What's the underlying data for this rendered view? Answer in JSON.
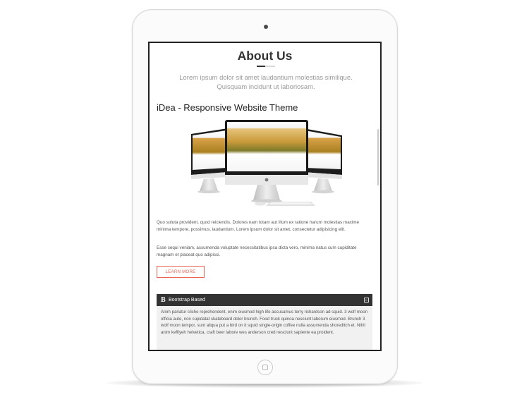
{
  "section": {
    "title": "About Us",
    "subtitle": "Lorem ipsum dolor sit amet laudantium molestias similique. Quisquam incidunt ut laboriosam."
  },
  "product": {
    "heading": "iDea - Responsive Website Theme"
  },
  "paragraphs": [
    "Quo soluta provident, quod reiciendis. Dolores nam totam aut illum ex ratione harum molestias maxime minima tempore, possimus, laudantium. Lorem ipsum dolor sit amet, consectetur adipisicing elit.",
    "Esse sequi veniam, assumenda voluptate necessitatibus ipsa dicta vero, minima natus cum cupiditate magnam et placeat quo adipisci."
  ],
  "learn_more_label": "LEARN MORE",
  "accordion": {
    "icon_text": "B",
    "title": "Bootstrap Based",
    "body": "Anim pariatur cliche reprehenderit, enim eiusmod high life accusamus terry richardson ad squid. 3 wolf moon officia aute, non cupidatat skateboard dolor brunch. Food truck quinoa nesciunt laborum eiusmod. Brunch 3 wolf moon tempor, sunt aliqua put a bird on it squid single-origin coffee nulla assumenda shoreditch et. Nihil anim keffiyeh helvetica, craft beer labore wes anderson cred nesciunt sapiente ea proident."
  },
  "colors": {
    "accent": "#e96656",
    "accordion_header": "#333333",
    "accordion_body": "#f1f1f1"
  }
}
